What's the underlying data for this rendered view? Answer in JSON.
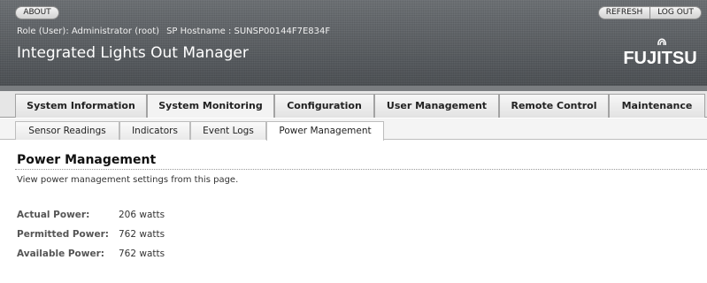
{
  "header": {
    "about_label": "ABOUT",
    "refresh_label": "REFRESH",
    "logout_label": "LOG OUT",
    "role_text": "Role (User): Administrator (root)",
    "hostname_text": "SP Hostname : SUNSP00144F7E834F",
    "app_title": "Integrated Lights Out Manager",
    "brand_logo": "FUJITSU"
  },
  "main_tabs": [
    {
      "label": "System Information"
    },
    {
      "label": "System Monitoring"
    },
    {
      "label": "Configuration"
    },
    {
      "label": "User Management"
    },
    {
      "label": "Remote Control"
    },
    {
      "label": "Maintenance"
    }
  ],
  "sub_tabs": [
    {
      "label": "Sensor Readings"
    },
    {
      "label": "Indicators"
    },
    {
      "label": "Event Logs"
    },
    {
      "label": "Power Management"
    }
  ],
  "content": {
    "title": "Power Management",
    "description": "View power management settings from this page.",
    "fields": [
      {
        "label": "Actual Power:",
        "value": "206 watts"
      },
      {
        "label": "Permitted Power:",
        "value": "762 watts"
      },
      {
        "label": "Available Power:",
        "value": "762 watts"
      }
    ]
  }
}
